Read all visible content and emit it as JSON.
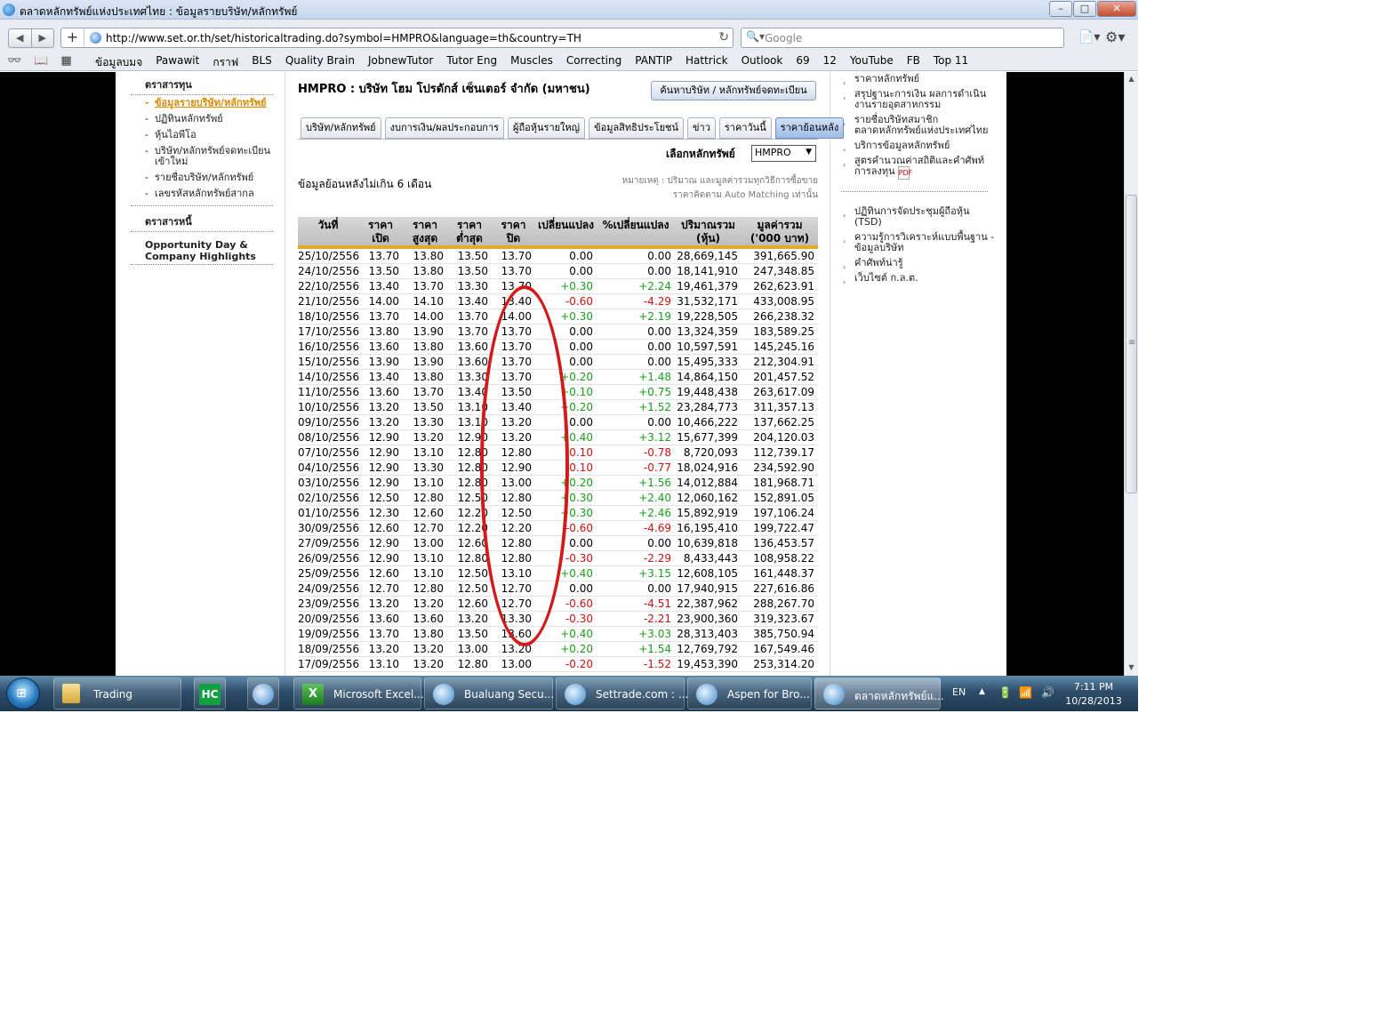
{
  "window": {
    "title": "ตลาดหลักทรัพย์แห่งประเทศไทย : ข้อมูลรายบริษัท/หลักทรัพย์",
    "minimize": "–",
    "maximize": "□",
    "close": "✕"
  },
  "toolbar": {
    "back": "◀",
    "forward": "▶",
    "add": "+",
    "url": "http://www.set.or.th/set/historicaltrading.do?symbol=HMPRO&language=th&country=TH",
    "reload": "↻",
    "search_placeholder": "Google",
    "search_icon": "🔍▾",
    "page_icon": "📄▾",
    "gear_icon": "⚙▾"
  },
  "bookmarks": {
    "icons": "👓📖▦",
    "items": [
      "ข้อมูลบมจ",
      "Pawawit",
      "กราฟ",
      "BLS",
      "Quality Brain",
      "JobnewTutor",
      "Tutor Eng",
      "Muscles",
      "Correcting",
      "PANTIP",
      "Hattrick",
      "Outlook",
      "69",
      "12",
      "YouTube",
      "FB",
      "Top 11"
    ]
  },
  "leftnav": {
    "head1": "ตราสารทุน",
    "items": [
      {
        "label": "ข้อมูลรายบริษัท/หลักทรัพย์",
        "active": true
      },
      {
        "label": "ปฏิทินหลักทรัพย์",
        "active": false
      },
      {
        "label": "หุ้นไอพีโอ",
        "active": false
      },
      {
        "label": "บริษัท/หลักทรัพย์จดทะเบียนเข้าใหม่",
        "active": false
      },
      {
        "label": "รายชื่อบริษัท/หลักทรัพย์",
        "active": false
      },
      {
        "label": "เลขรหัสหลักทรัพย์สากล",
        "active": false
      }
    ],
    "head2": "ตราสารหนี้",
    "head3": "Opportunity Day & Company Highlights",
    "dash": "-"
  },
  "main": {
    "company": "HMPRO : บริษัท โฮม โปรดักส์ เซ็นเตอร์ จำกัด (มหาชน)",
    "find_button": "ค้นหาบริษัท / หลักทรัพย์จดทะเบียน",
    "tabs": [
      "บริษัท/หลักทรัพย์",
      "งบการเงิน/ผลประกอบการ",
      "ผู้ถือหุ้นรายใหญ่",
      "ข้อมูลสิทธิประโยชน์",
      "ข่าว",
      "ราคาวันนี้",
      "ราคาย้อนหลัง"
    ],
    "active_tab": 6,
    "select_label": "เลือกหลักทรัพย์",
    "select_value": "HMPRO",
    "select_caret": "▼",
    "subtitle": "ข้อมูลย้อนหลังไม่เกิน 6 เดือน",
    "note1": "หมายเหตุ : ปริมาณ และมูลค่ารวมทุกวิธีการซื้อขาย",
    "note2": "ราคาคิดตาม Auto Matching เท่านั้น"
  },
  "table": {
    "headers": [
      "วันที่",
      "ราคา\nเปิด",
      "ราคา\nสูงสุด",
      "ราคา\nต่ำสุด",
      "ราคา\nปิด",
      "เปลี่ยนแปลง",
      "%เปลี่ยนแปลง",
      "ปริมาณรวม\n(หุ้น)",
      "มูลค่ารวม\n('000 บาท)"
    ],
    "rows": [
      [
        "25/10/2556",
        "13.70",
        "13.80",
        "13.50",
        "13.70",
        "0.00",
        "0.00",
        "28,669,145",
        "391,665.90"
      ],
      [
        "24/10/2556",
        "13.50",
        "13.80",
        "13.50",
        "13.70",
        "0.00",
        "0.00",
        "18,141,910",
        "247,348.85"
      ],
      [
        "22/10/2556",
        "13.40",
        "13.70",
        "13.30",
        "13.70",
        "+0.30",
        "+2.24",
        "19,461,379",
        "262,623.91"
      ],
      [
        "21/10/2556",
        "14.00",
        "14.10",
        "13.40",
        "13.40",
        "-0.60",
        "-4.29",
        "31,532,171",
        "433,008.95"
      ],
      [
        "18/10/2556",
        "13.70",
        "14.00",
        "13.70",
        "14.00",
        "+0.30",
        "+2.19",
        "19,228,505",
        "266,238.32"
      ],
      [
        "17/10/2556",
        "13.80",
        "13.90",
        "13.70",
        "13.70",
        "0.00",
        "0.00",
        "13,324,359",
        "183,589.25"
      ],
      [
        "16/10/2556",
        "13.60",
        "13.80",
        "13.60",
        "13.70",
        "0.00",
        "0.00",
        "10,597,591",
        "145,245.16"
      ],
      [
        "15/10/2556",
        "13.90",
        "13.90",
        "13.60",
        "13.70",
        "0.00",
        "0.00",
        "15,495,333",
        "212,304.91"
      ],
      [
        "14/10/2556",
        "13.40",
        "13.80",
        "13.30",
        "13.70",
        "+0.20",
        "+1.48",
        "14,864,150",
        "201,457.52"
      ],
      [
        "11/10/2556",
        "13.60",
        "13.70",
        "13.40",
        "13.50",
        "+0.10",
        "+0.75",
        "19,448,438",
        "263,617.09"
      ],
      [
        "10/10/2556",
        "13.20",
        "13.50",
        "13.10",
        "13.40",
        "+0.20",
        "+1.52",
        "23,284,773",
        "311,357.13"
      ],
      [
        "09/10/2556",
        "13.20",
        "13.30",
        "13.10",
        "13.20",
        "0.00",
        "0.00",
        "10,466,222",
        "137,662.25"
      ],
      [
        "08/10/2556",
        "12.90",
        "13.20",
        "12.90",
        "13.20",
        "+0.40",
        "+3.12",
        "15,677,399",
        "204,120.03"
      ],
      [
        "07/10/2556",
        "12.90",
        "13.10",
        "12.80",
        "12.80",
        "-0.10",
        "-0.78",
        "8,720,093",
        "112,739.17"
      ],
      [
        "04/10/2556",
        "12.90",
        "13.30",
        "12.80",
        "12.90",
        "-0.10",
        "-0.77",
        "18,024,916",
        "234,592.90"
      ],
      [
        "03/10/2556",
        "12.90",
        "13.10",
        "12.80",
        "13.00",
        "+0.20",
        "+1.56",
        "14,012,884",
        "181,968.71"
      ],
      [
        "02/10/2556",
        "12.50",
        "12.80",
        "12.50",
        "12.80",
        "+0.30",
        "+2.40",
        "12,060,162",
        "152,891.05"
      ],
      [
        "01/10/2556",
        "12.30",
        "12.60",
        "12.20",
        "12.50",
        "+0.30",
        "+2.46",
        "15,892,919",
        "197,106.24"
      ],
      [
        "30/09/2556",
        "12.60",
        "12.70",
        "12.20",
        "12.20",
        "-0.60",
        "-4.69",
        "16,195,410",
        "199,722.47"
      ],
      [
        "27/09/2556",
        "12.90",
        "13.00",
        "12.60",
        "12.80",
        "0.00",
        "0.00",
        "10,639,818",
        "136,453.57"
      ],
      [
        "26/09/2556",
        "12.90",
        "13.10",
        "12.80",
        "12.80",
        "-0.30",
        "-2.29",
        "8,433,443",
        "108,958.22"
      ],
      [
        "25/09/2556",
        "12.60",
        "13.10",
        "12.50",
        "13.10",
        "+0.40",
        "+3.15",
        "12,608,105",
        "161,448.37"
      ],
      [
        "24/09/2556",
        "12.70",
        "12.80",
        "12.50",
        "12.70",
        "0.00",
        "0.00",
        "17,940,915",
        "227,616.86"
      ],
      [
        "23/09/2556",
        "13.20",
        "13.20",
        "12.60",
        "12.70",
        "-0.60",
        "-4.51",
        "22,387,962",
        "288,267.70"
      ],
      [
        "20/09/2556",
        "13.60",
        "13.60",
        "13.20",
        "13.30",
        "-0.30",
        "-2.21",
        "23,900,360",
        "319,323.67"
      ],
      [
        "19/09/2556",
        "13.70",
        "13.80",
        "13.50",
        "13.60",
        "+0.40",
        "+3.03",
        "28,313,403",
        "385,750.94"
      ],
      [
        "18/09/2556",
        "13.20",
        "13.20",
        "13.00",
        "13.20",
        "+0.20",
        "+1.54",
        "12,769,792",
        "167,549.46"
      ],
      [
        "17/09/2556",
        "13.10",
        "13.20",
        "12.80",
        "13.00",
        "-0.20",
        "-1.52",
        "19,453,390",
        "253,314.20"
      ]
    ]
  },
  "rightnav": {
    "arrow": "›",
    "items_top": [
      "ราคาหลักทรัพย์",
      "สรุปฐานะการเงิน ผลการดำเนินงานรายอุตสาหกรรม",
      "รายชื่อบริษัทสมาชิกตลาดหลักทรัพย์แห่งประเทศไทย",
      "บริการข้อมูลหลักทรัพย์",
      "สูตรคำนวณค่าสถิติและคำศัพท์การลงทุน"
    ],
    "pdf": "PDF",
    "items_bottom": [
      "ปฏิทินการจัดประชุมผู้ถือหุ้น (TSD)",
      "ความรู้การวิเคราะห์แบบพื้นฐาน - ข้อมูลบริษัท",
      "คำศัพท์น่ารู้",
      "เว็บไซต์ ก.ล.ต."
    ]
  },
  "scrollbar": {
    "up": "▲",
    "down": "▼",
    "grip": "≡"
  },
  "taskbar": {
    "start_flag": "⊞",
    "buttons": [
      {
        "label": "Trading",
        "icon": "folder"
      },
      {
        "label": "HC",
        "icon": "hc"
      },
      {
        "label": "",
        "icon": "browser"
      },
      {
        "label": "Microsoft Excel...",
        "icon": "excel"
      },
      {
        "label": "Bualuang Secu...",
        "icon": "browser"
      },
      {
        "label": "Settrade.com : ...",
        "icon": "browser"
      },
      {
        "label": "Aspen for Bro...",
        "icon": "browser"
      },
      {
        "label": "ตลาดหลักทรัพย์แ...",
        "icon": "browser"
      }
    ],
    "lang": "EN",
    "tray_up": "▲",
    "tray_icons": [
      "🔋",
      "📶",
      "🔊"
    ],
    "time": "7:11 PM",
    "date": "10/28/2013"
  },
  "colors": {
    "positive": "#1aa01a",
    "negative": "#d01010",
    "accent": "#e9a825",
    "annotation": "#d21a1a"
  }
}
